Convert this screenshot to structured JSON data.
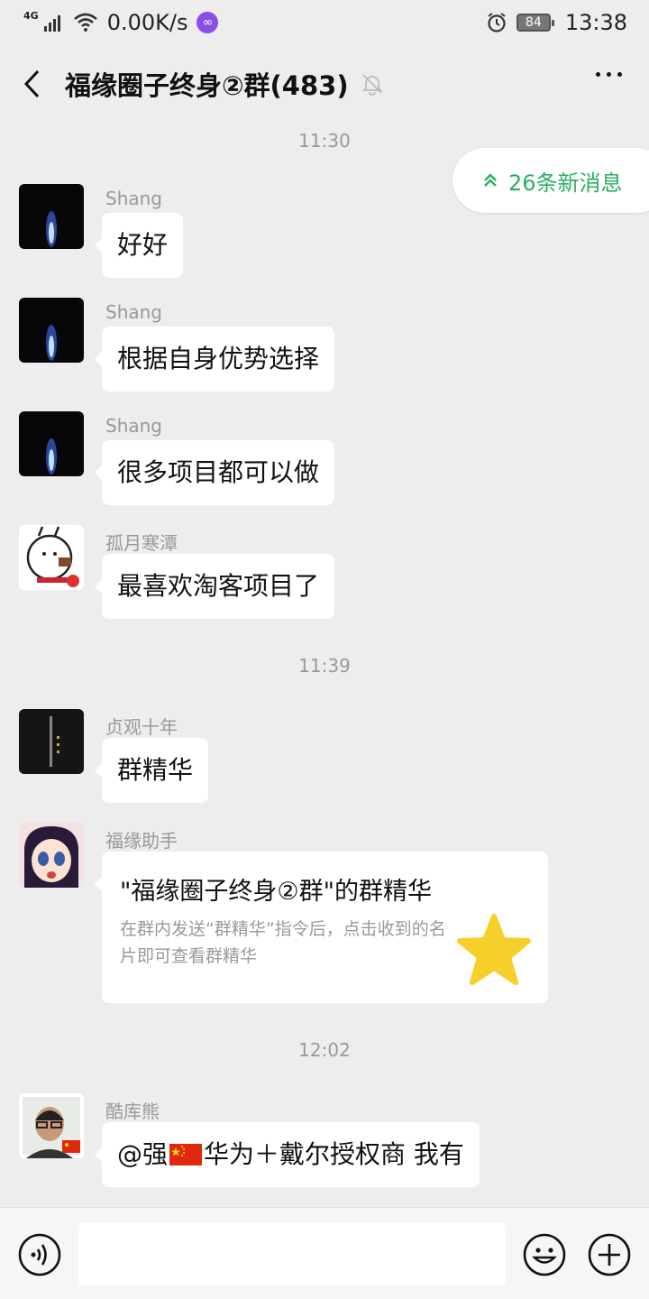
{
  "status_bar": {
    "network": "4G",
    "speed": "0.00K/s",
    "battery": "84",
    "time": "13:38"
  },
  "header": {
    "title": "福缘圈子终身②群(483)"
  },
  "new_messages_label": "26条新消息",
  "timestamps": [
    "11:30",
    "11:39",
    "12:02"
  ],
  "messages": [
    {
      "sender": "Shang",
      "text": "好好"
    },
    {
      "sender": "Shang",
      "text": "根据自身优势选择"
    },
    {
      "sender": "Shang",
      "text": "很多项目都可以做"
    },
    {
      "sender": "孤月寒潭",
      "text": "最喜欢淘客项目了"
    },
    {
      "sender": "贞观十年",
      "text": "群精华"
    },
    {
      "sender": "福缘助手",
      "card": {
        "title": "\"福缘圈子终身②群\"的群精华",
        "description": "在群内发送“群精华”指令后，点击收到的名片即可查看群精华"
      }
    },
    {
      "sender": "酷库熊",
      "text_prefix": "@强",
      "text_suffix": "华为＋戴尔授权商  我有"
    }
  ],
  "input_bar": {
    "placeholder": ""
  },
  "colors": {
    "accent_green": "#2bae61",
    "background": "#ededed",
    "star": "#f7cf2a"
  }
}
